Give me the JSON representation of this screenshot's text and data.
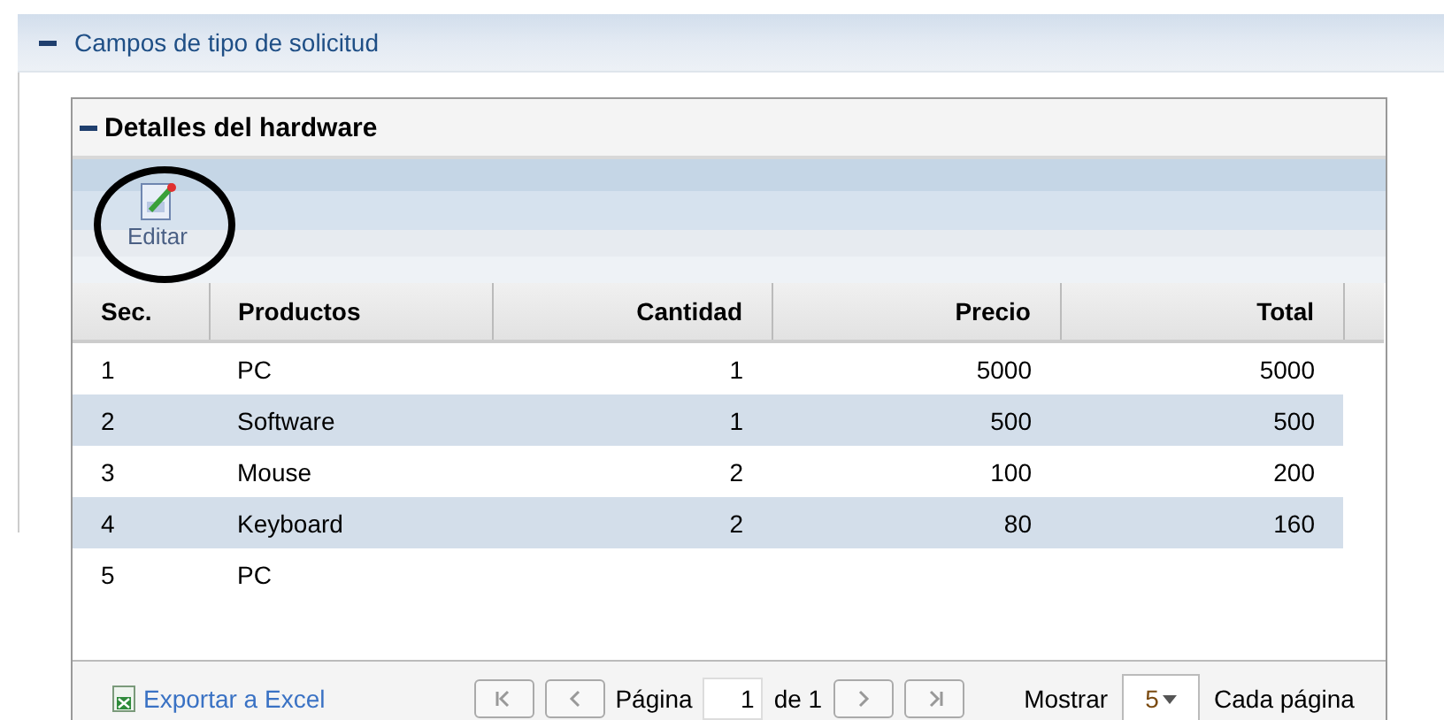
{
  "section": {
    "title": "Campos de tipo de solicitud",
    "expanded": true
  },
  "panel": {
    "title": "Detalles del hardware",
    "expanded": true
  },
  "toolbar": {
    "edit_label": "Editar"
  },
  "table": {
    "columns": [
      "Sec.",
      "Productos",
      "Cantidad",
      "Precio",
      "Total"
    ],
    "rows": [
      {
        "sec": "1",
        "producto": "PC",
        "cantidad": "1",
        "precio": "5000",
        "total": "5000"
      },
      {
        "sec": "2",
        "producto": "Software",
        "cantidad": "1",
        "precio": "500",
        "total": "500"
      },
      {
        "sec": "3",
        "producto": "Mouse",
        "cantidad": "2",
        "precio": "100",
        "total": "200"
      },
      {
        "sec": "4",
        "producto": "Keyboard",
        "cantidad": "2",
        "precio": "80",
        "total": "160"
      },
      {
        "sec": "5",
        "producto": "PC"
      }
    ]
  },
  "footer": {
    "export_label": "Exportar a Excel",
    "page_label": "Página",
    "page_value": "1",
    "page_total": "de 1",
    "show_label": "Mostrar",
    "page_size": "5",
    "per_page_label": "Cada página"
  }
}
